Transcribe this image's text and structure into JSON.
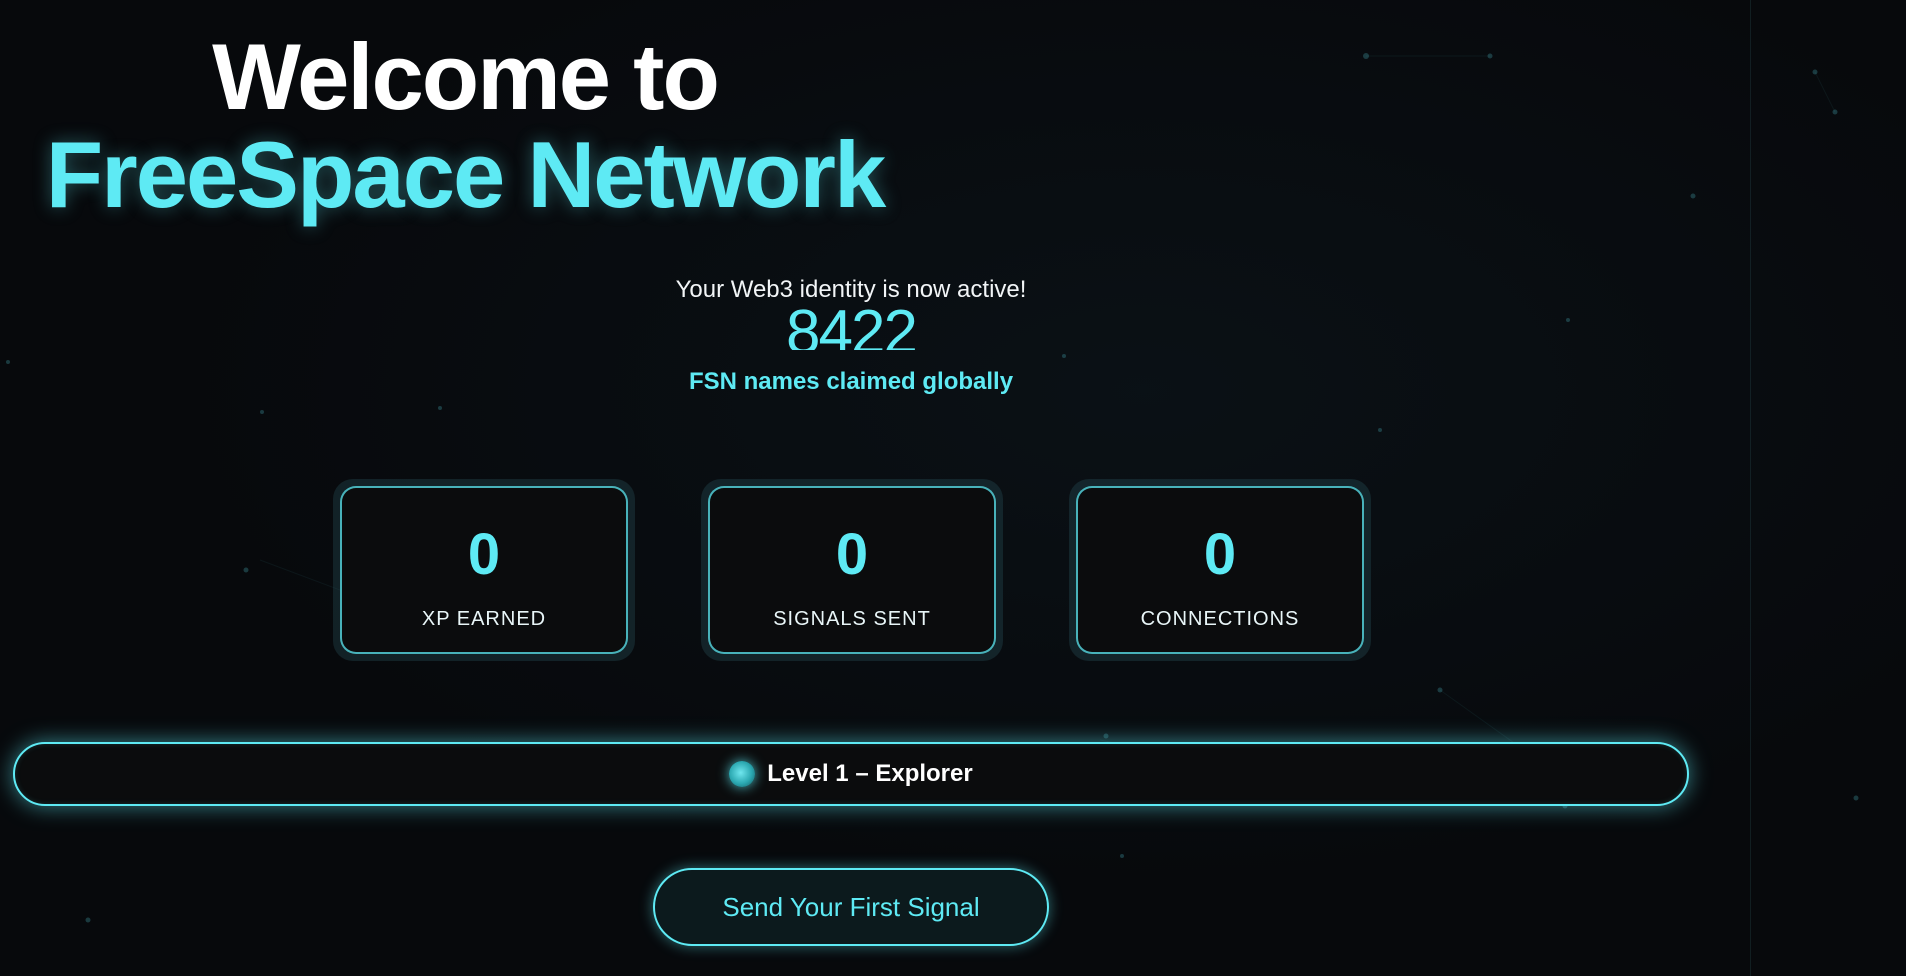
{
  "hero": {
    "welcome": "Welcome to",
    "network_name": "FreeSpace Network"
  },
  "identity": {
    "status_text": "Your Web3 identity is now active!",
    "claimed_count": "8422",
    "claimed_caption": "FSN names claimed globally"
  },
  "stats": [
    {
      "value": "0",
      "label": "XP EARNED"
    },
    {
      "value": "0",
      "label": "SIGNALS SENT"
    },
    {
      "value": "0",
      "label": "CONNECTIONS"
    }
  ],
  "level": {
    "text": "Level 1 – Explorer"
  },
  "cta": {
    "label": "Send Your First Signal"
  },
  "theme": {
    "accent": "#5eeaf4",
    "background": "#07090c",
    "card_background": "#0b0c0d"
  }
}
